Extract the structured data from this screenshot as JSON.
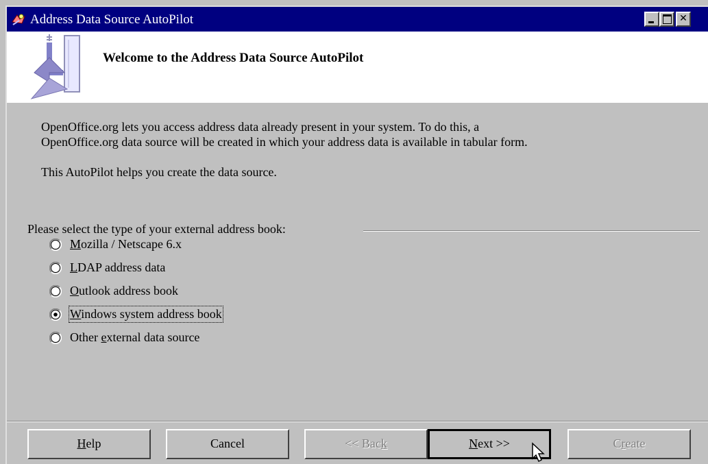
{
  "window": {
    "title": "Address Data Source AutoPilot"
  },
  "banner": {
    "title": "Welcome to the Address Data Source AutoPilot"
  },
  "intro": {
    "line1": "OpenOffice.org lets you access address data already present in your system. To do this, a",
    "line2": "OpenOffice.org data source will be created in which your address data is available in tabular form.",
    "line3": "This AutoPilot helps you create the data source."
  },
  "group": {
    "label": "Please select the type of your external address book:"
  },
  "options": [
    {
      "pre": "",
      "key": "M",
      "post": "ozilla / Netscape 6.x",
      "selected": false
    },
    {
      "pre": "",
      "key": "L",
      "post": "DAP address data",
      "selected": false
    },
    {
      "pre": "",
      "key": "O",
      "post": "utlook address book",
      "selected": false
    },
    {
      "pre": "",
      "key": "W",
      "post": "indows system address book",
      "selected": true
    },
    {
      "pre": "Other ",
      "key": "e",
      "post": "xternal data source",
      "selected": false
    }
  ],
  "buttons": {
    "help": {
      "pre": "",
      "key": "H",
      "post": "elp"
    },
    "cancel": {
      "label": "Cancel"
    },
    "back": {
      "pre": "<< Bac",
      "key": "k",
      "post": ""
    },
    "next": {
      "pre": "",
      "key": "N",
      "post": "ext >>"
    },
    "create": {
      "pre": "C",
      "key": "r",
      "post": "eate"
    }
  },
  "colors": {
    "titlebar": "#000080",
    "face": "#c0c0c0",
    "banner": "#ffffff",
    "disabled_text": "#808080"
  },
  "icons": {
    "title": "autopilot-wand-icon",
    "banner": "autopilot-arrow-graphic",
    "minimize": "minimize-icon",
    "maximize": "maximize-icon",
    "close": "close-icon",
    "cursor": "mouse-pointer-icon"
  }
}
